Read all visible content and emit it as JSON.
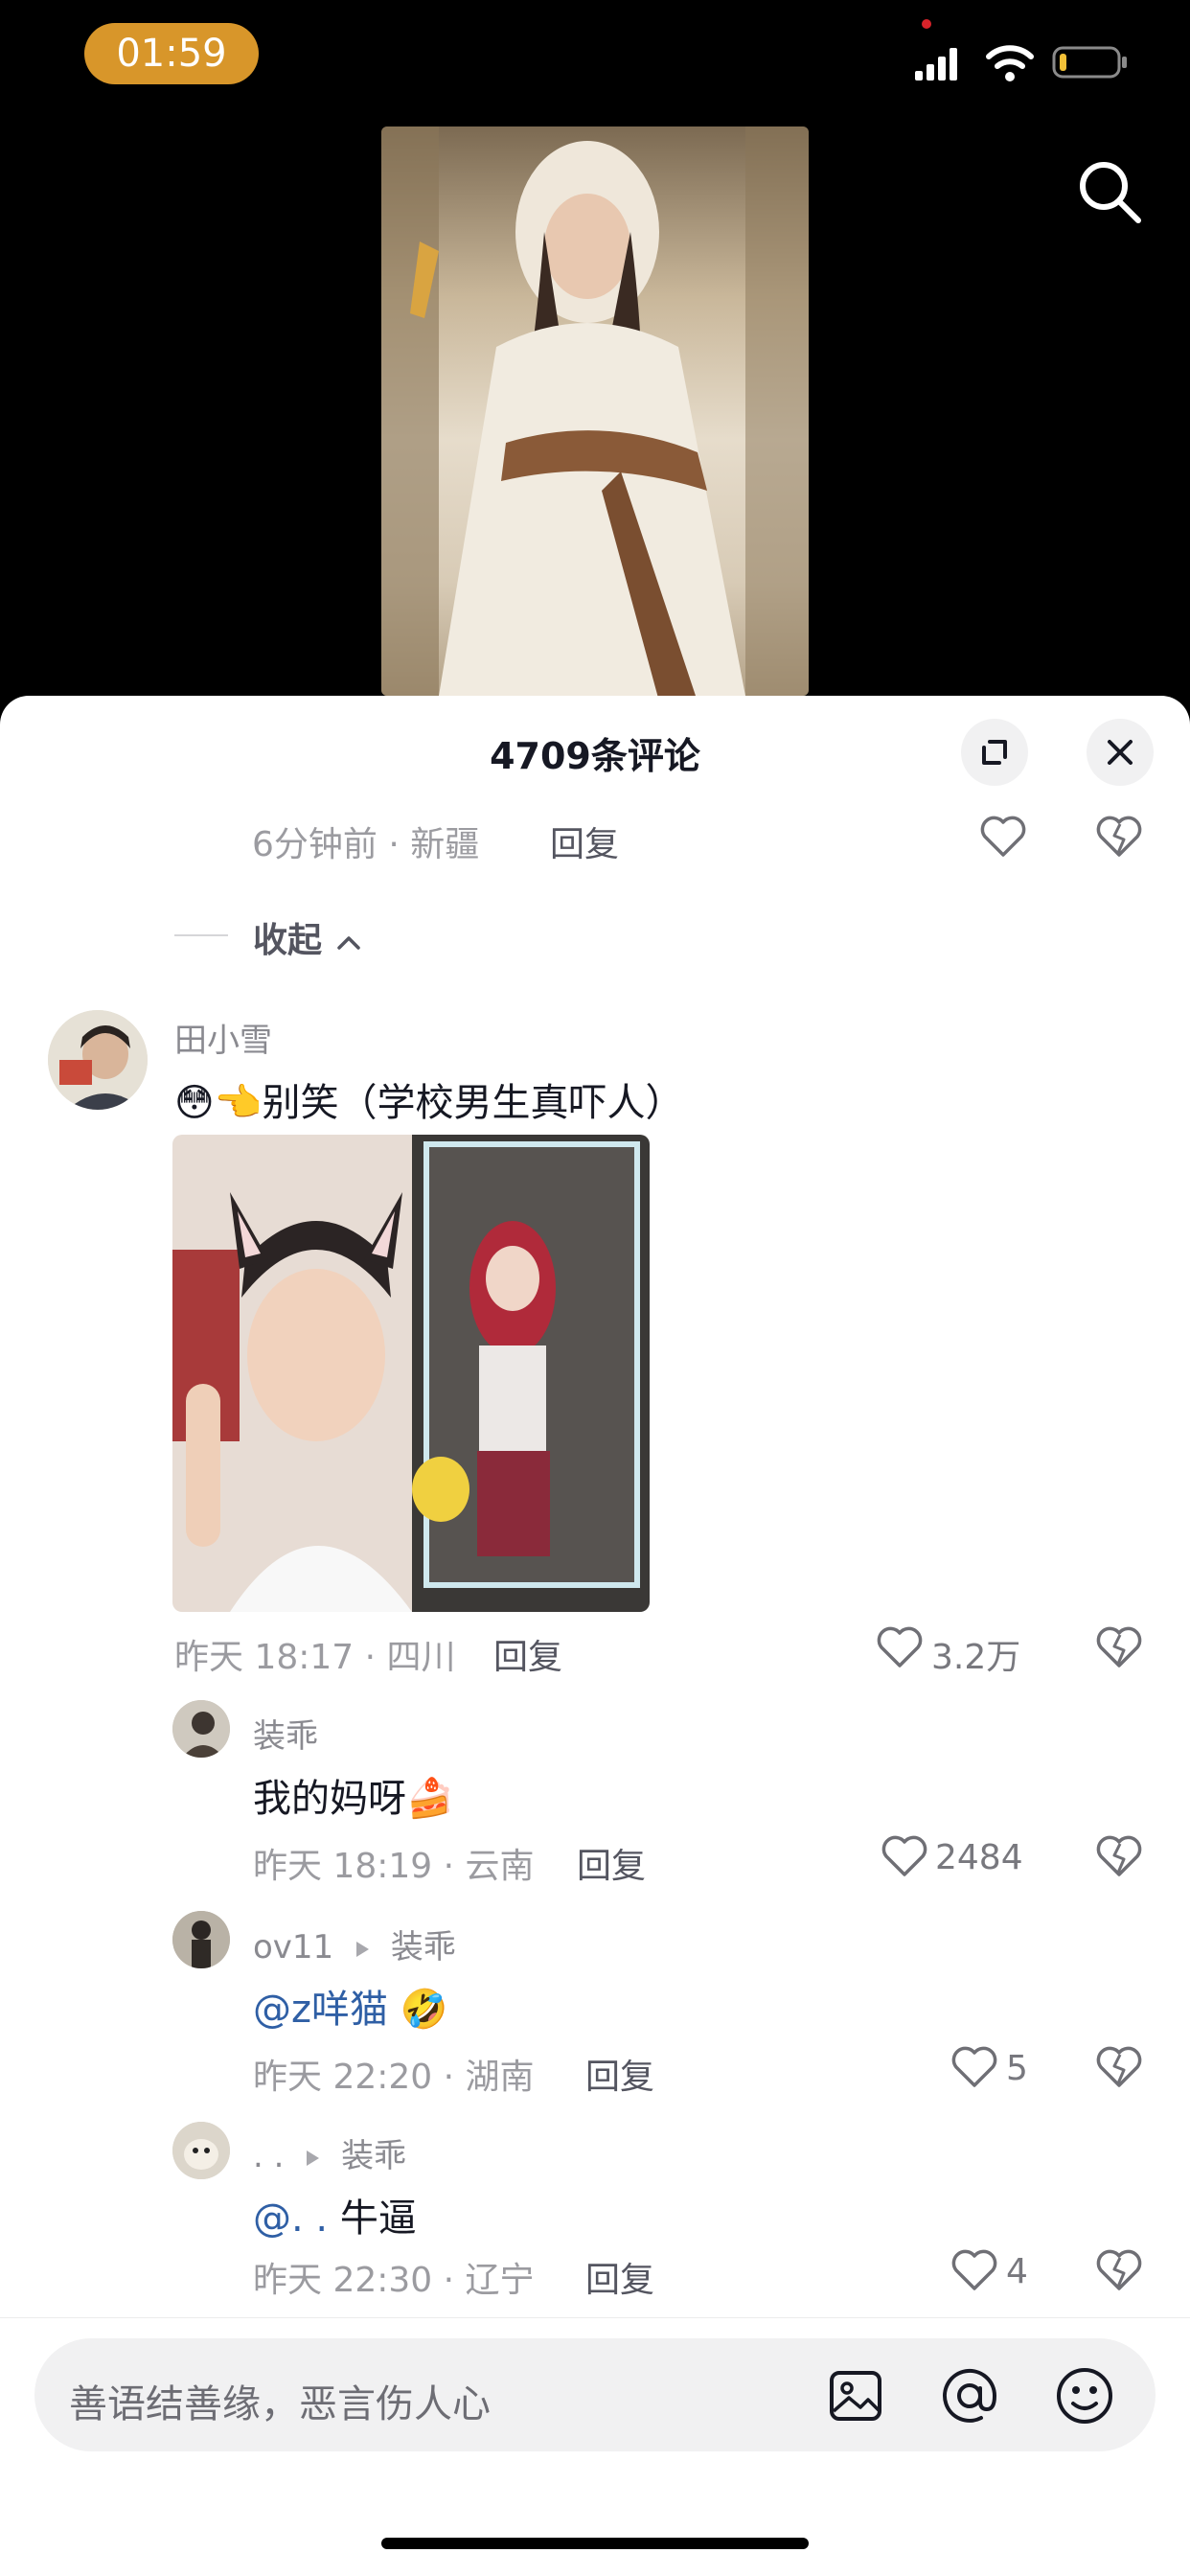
{
  "status": {
    "time": "01:59"
  },
  "video": {
    "search_icon": "search-icon"
  },
  "sheet": {
    "title": "4709条评论",
    "expand_icon": "expand-icon",
    "close_icon": "close-icon"
  },
  "prev_comment": {
    "meta": "6分钟前 · 新疆",
    "reply": "回复"
  },
  "collapse_label": "收起",
  "comment": {
    "username": "田小雪",
    "emoji": "😳👈",
    "text": "别笑（学校男生真吓人）",
    "meta": "昨天 18:17 · 四川",
    "reply": "回复",
    "likes": "3.2万"
  },
  "replies": [
    {
      "username": "装乖",
      "target": "",
      "mention": "",
      "text": "我的妈呀",
      "emoji": "🍰",
      "meta": "昨天 18:19 · 云南",
      "reply": "回复",
      "likes": "2484"
    },
    {
      "username": "ov11",
      "target": "装乖",
      "mention": "@z咩猫",
      "text": "",
      "emoji": "🤣",
      "meta": "昨天 22:20 · 湖南",
      "reply": "回复",
      "likes": "5"
    },
    {
      "username": ". .",
      "target": "装乖",
      "mention": "@. .",
      "text": "牛逼",
      "emoji": "",
      "meta": "昨天 22:30 · 辽宁",
      "reply": "回复",
      "likes": "4"
    }
  ],
  "input": {
    "placeholder": "善语结善缘，恶言伤人心",
    "icons": [
      "image-icon",
      "at-icon",
      "emoji-icon"
    ]
  },
  "colors": {
    "accent": "#d8962a",
    "mention": "#2f5fa5",
    "text": "#161823",
    "meta": "#9b9ba0"
  }
}
